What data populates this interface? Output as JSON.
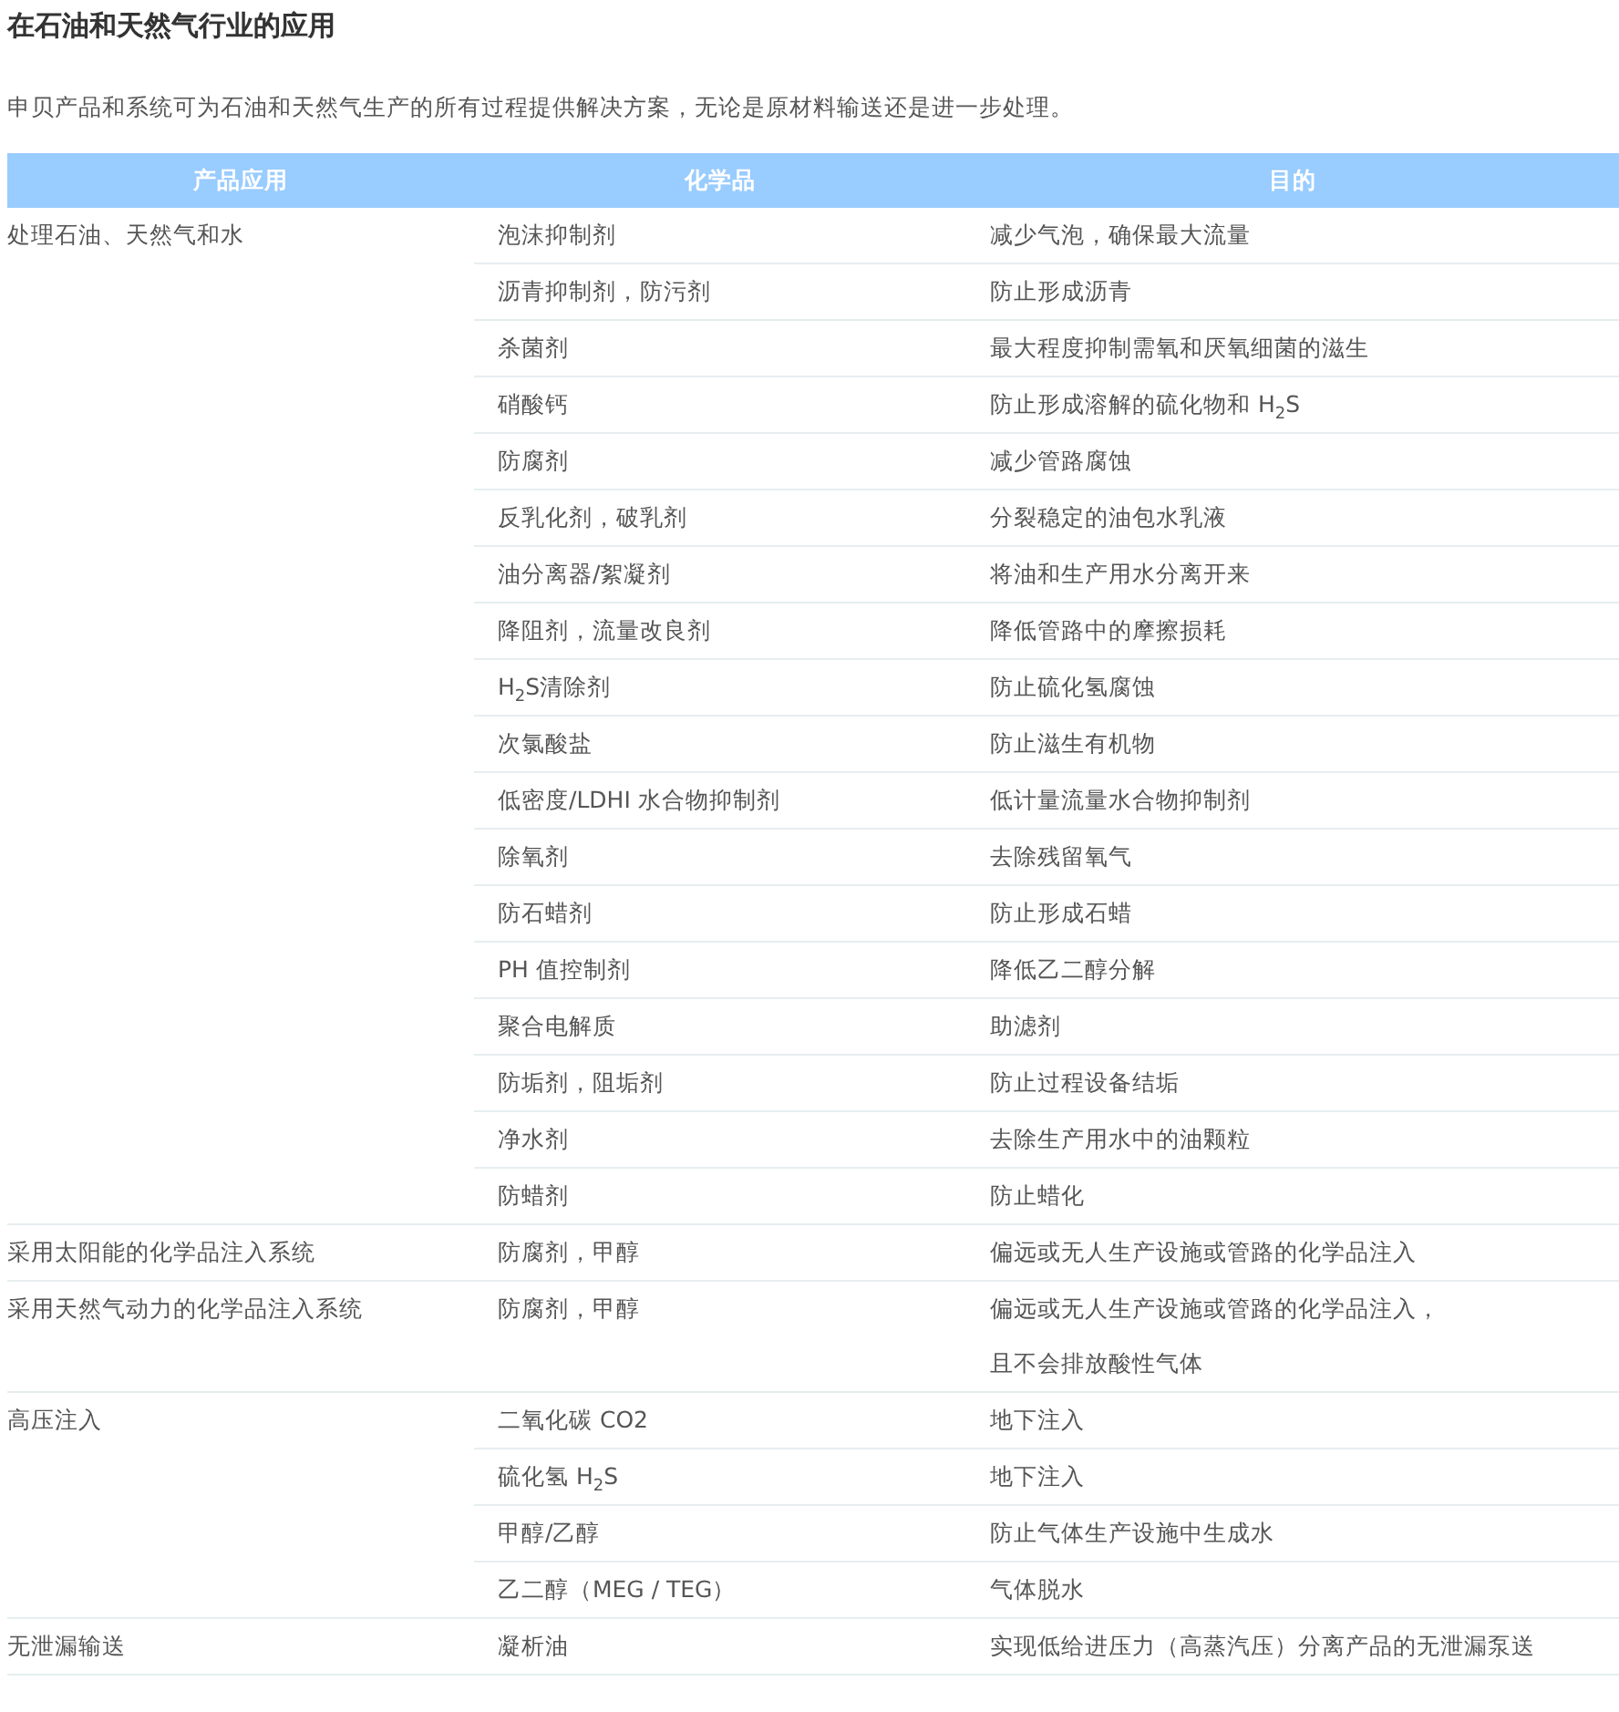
{
  "title": "在石油和天然气行业的应用",
  "intro": "申贝产品和系统可为石油和天然气生产的所有过程提供解决方案，无论是原材料输送还是进一步处理。",
  "table": {
    "columns": [
      "产品应用",
      "化学品",
      "目的"
    ],
    "groups": [
      {
        "application": "处理石油、天然气和水",
        "rows": [
          {
            "chemical": "泡沫抑制剂",
            "purpose": [
              "减少气泡，确保最大流量"
            ]
          },
          {
            "chemical": "沥青抑制剂，防污剂",
            "purpose": [
              "防止形成沥青"
            ]
          },
          {
            "chemical": "杀菌剂",
            "purpose": [
              "最大程度抑制需氧和厌氧细菌的滋生"
            ]
          },
          {
            "chemical": "硝酸钙",
            "purpose": [
              "防止形成溶解的硫化物和 H$_{2}$S"
            ]
          },
          {
            "chemical": "防腐剂",
            "purpose": [
              "减少管路腐蚀"
            ]
          },
          {
            "chemical": "反乳化剂，破乳剂",
            "purpose": [
              "分裂稳定的油包水乳液"
            ]
          },
          {
            "chemical": "油分离器/絮凝剂",
            "purpose": [
              "将油和生产用水分离开来"
            ]
          },
          {
            "chemical": "降阻剂，流量改良剂",
            "purpose": [
              "降低管路中的摩擦损耗"
            ]
          },
          {
            "chemical": "H$_{2}$S清除剂",
            "purpose": [
              "防止硫化氢腐蚀"
            ]
          },
          {
            "chemical": "次氯酸盐",
            "purpose": [
              "防止滋生有机物"
            ]
          },
          {
            "chemical": "低密度/LDHI 水合物抑制剂",
            "purpose": [
              "低计量流量水合物抑制剂"
            ]
          },
          {
            "chemical": "除氧剂",
            "purpose": [
              "去除残留氧气"
            ]
          },
          {
            "chemical": "防石蜡剂",
            "purpose": [
              "防止形成石蜡"
            ]
          },
          {
            "chemical": "PH 值控制剂",
            "purpose": [
              "降低乙二醇分解"
            ]
          },
          {
            "chemical": "聚合电解质",
            "purpose": [
              "助滤剂"
            ]
          },
          {
            "chemical": "防垢剂，阻垢剂",
            "purpose": [
              "防止过程设备结垢"
            ]
          },
          {
            "chemical": "净水剂",
            "purpose": [
              "去除生产用水中的油颗粒"
            ]
          },
          {
            "chemical": "防蜡剂",
            "purpose": [
              "防止蜡化"
            ]
          }
        ]
      },
      {
        "application": "采用太阳能的化学品注入系统",
        "rows": [
          {
            "chemical": "防腐剂，甲醇",
            "purpose": [
              "偏远或无人生产设施或管路的化学品注入"
            ]
          }
        ]
      },
      {
        "application": "采用天然气动力的化学品注入系统",
        "rows": [
          {
            "chemical": "防腐剂，甲醇",
            "purpose": [
              "偏远或无人生产设施或管路的化学品注入，",
              "且不会排放酸性气体"
            ]
          }
        ]
      },
      {
        "application": "高压注入",
        "rows": [
          {
            "chemical": "二氧化碳 CO2",
            "purpose": [
              "地下注入"
            ]
          },
          {
            "chemical": "硫化氢 H$_{2}$S",
            "purpose": [
              "地下注入"
            ]
          },
          {
            "chemical": "甲醇/乙醇",
            "purpose": [
              "防止气体生产设施中生成水"
            ]
          },
          {
            "chemical": "乙二醇（MEG / TEG）",
            "purpose": [
              "气体脱水"
            ]
          }
        ]
      },
      {
        "application": "无泄漏输送",
        "rows": [
          {
            "chemical": "凝析油",
            "purpose": [
              "实现低给进压力（高蒸汽压）分离产品的无泄漏泵送"
            ]
          }
        ]
      }
    ]
  }
}
